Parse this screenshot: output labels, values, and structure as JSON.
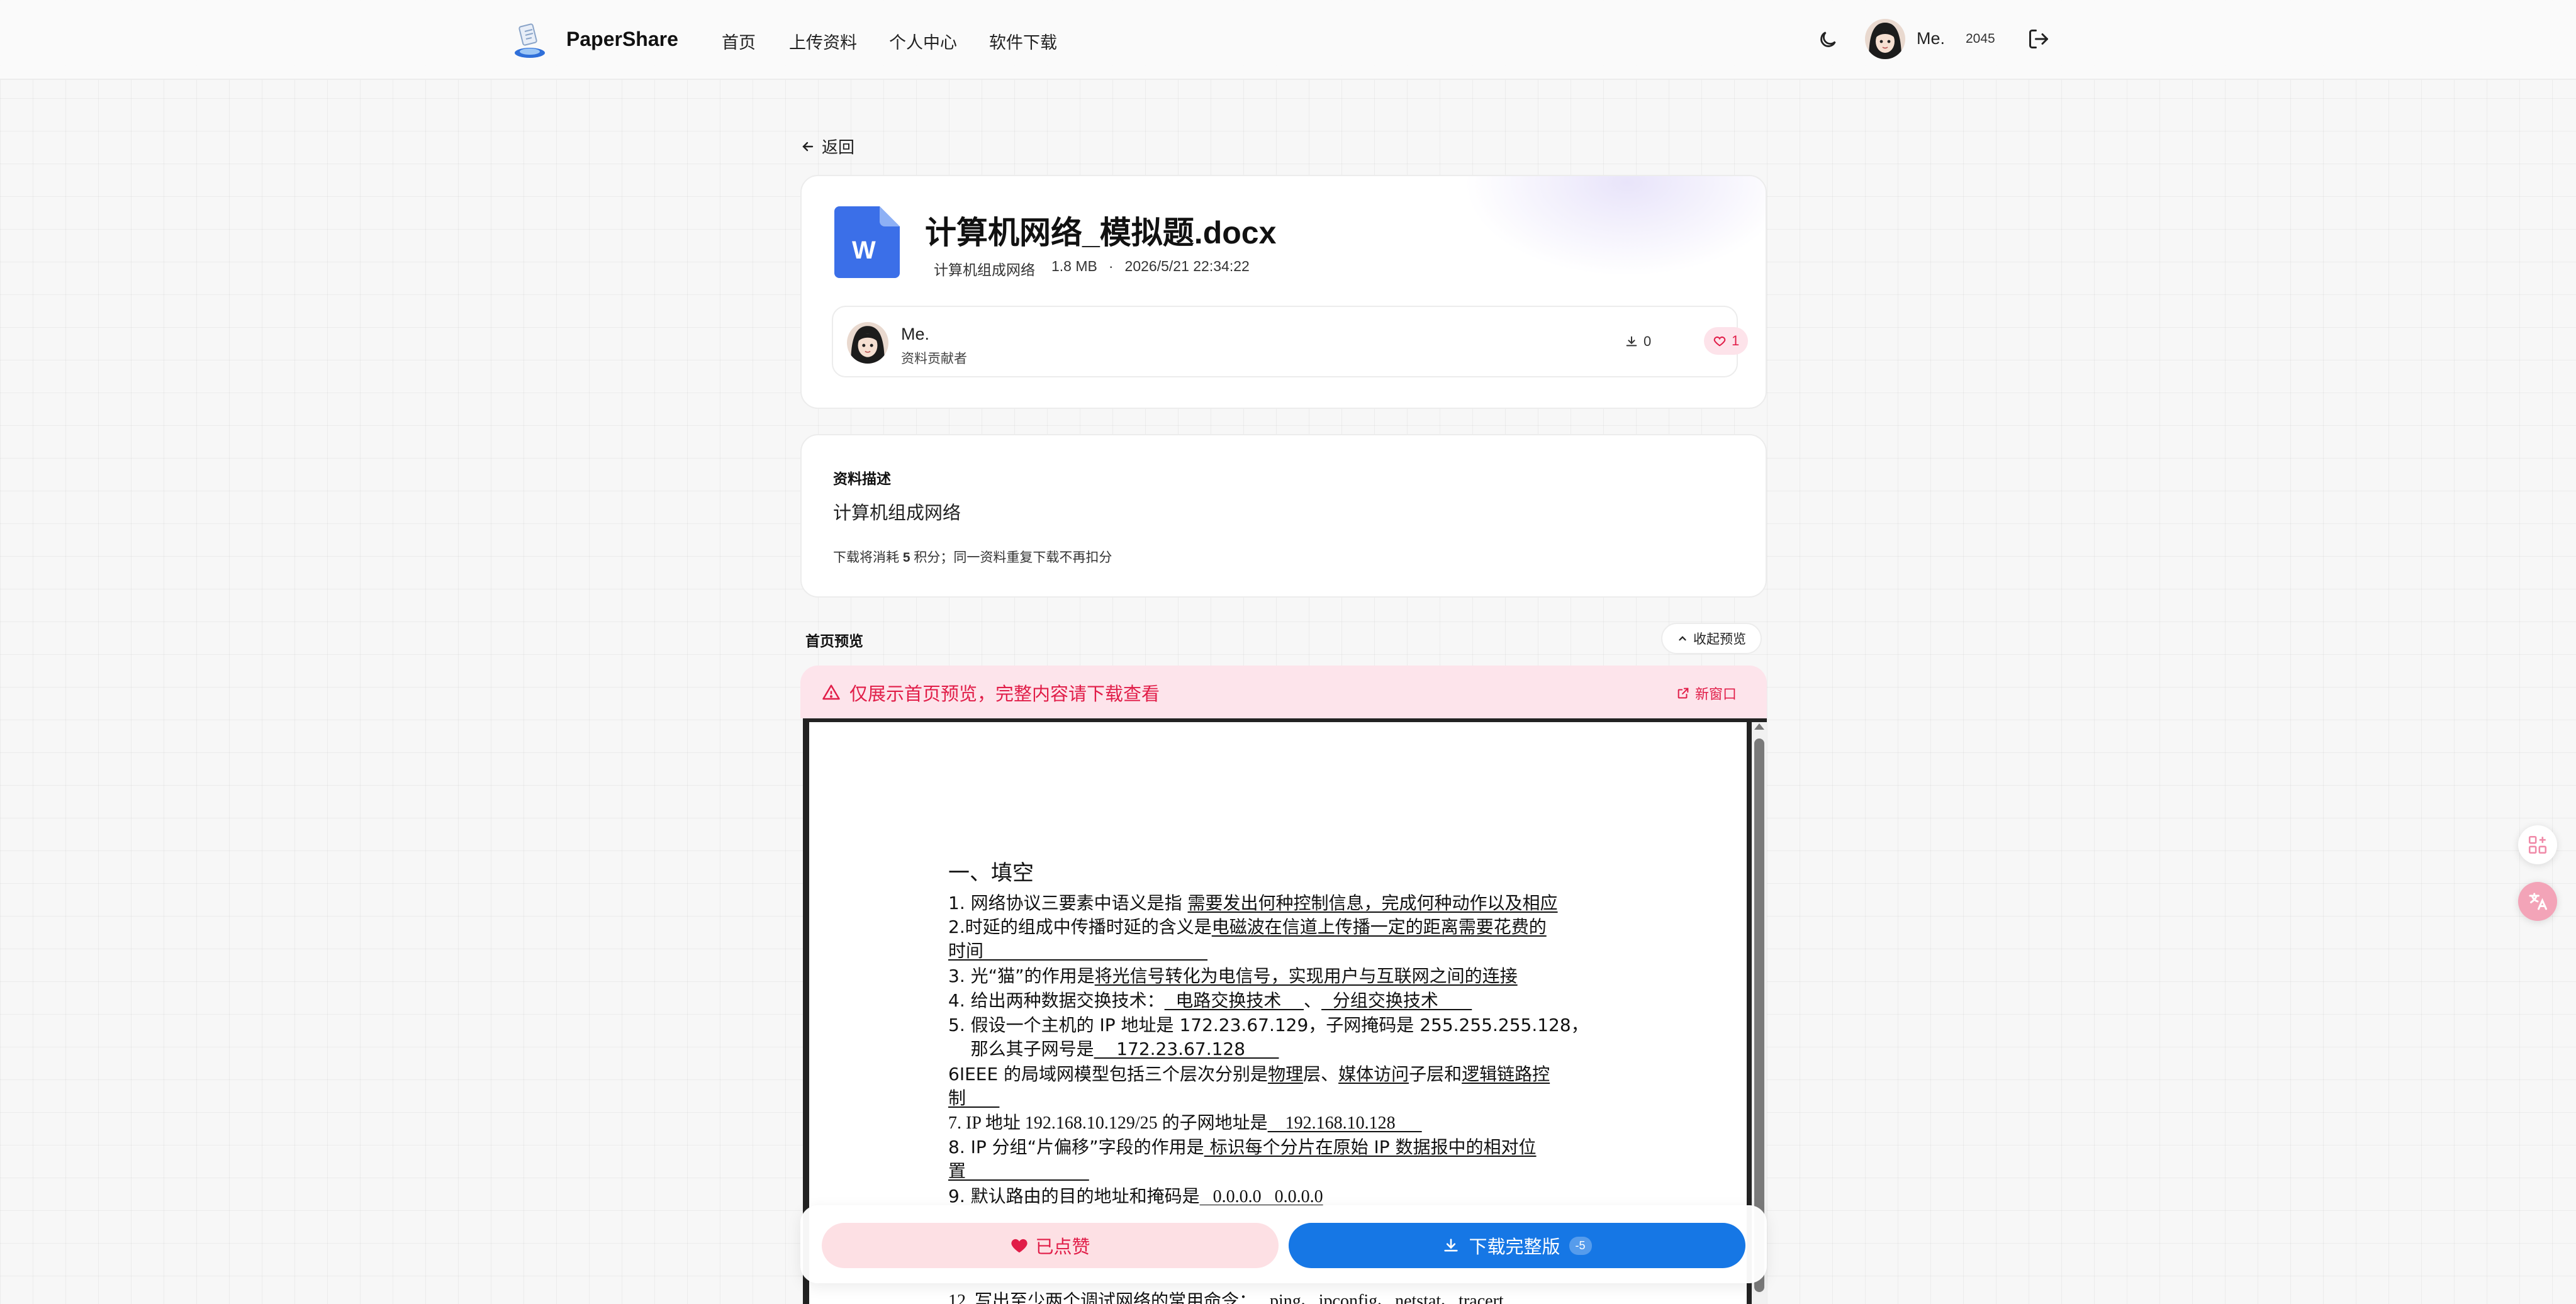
{
  "header": {
    "brand": "PaperShare",
    "nav": [
      "首页",
      "上传资料",
      "个人中心",
      "软件下载"
    ],
    "user_name": "Me.",
    "points": "2045"
  },
  "back_label": "返回",
  "file": {
    "title": "计算机网络_模拟题.docx",
    "category": "计算机组成网络",
    "size": "1.8 MB",
    "separator": "·",
    "date": "2026/5/21 22:34:22",
    "icon_letter": "W",
    "uploader": {
      "name": "Me.",
      "role": "资料贡献者"
    },
    "downloads": "0",
    "likes": "1"
  },
  "description": {
    "label": "资料描述",
    "text": "计算机组成网络",
    "note_prefix": "下载将消耗 ",
    "note_points": "5",
    "note_suffix": " 积分；同一资料重复下载不再扣分"
  },
  "preview": {
    "label": "首页预览",
    "collapse_label": "收起预览",
    "notice": "仅展示首页预览，完整内容请下载查看",
    "new_window": "新窗口"
  },
  "document": {
    "heading": "一、填空",
    "lines": [
      {
        "pre": "1. 网络协议三要素中语义是指 ",
        "u": "需要发出何种控制信息，完成何种动作以及相应",
        "post": ""
      },
      {
        "pre": "2.时延的组成中传播时延的含义是",
        "u": "电磁波在信道上传播一定的距离需要花费的",
        "post": ""
      },
      {
        "pre": "",
        "u": "时间                                        ",
        "post": ""
      },
      {
        "pre": "3. 光“猫”的作用是",
        "u": "将光信号转化为电信号，实现用户与互联网之间的连接",
        "post": ""
      },
      {
        "pre": "4. 给出两种数据交换技术：",
        "u": "  电路交换技术    ",
        "post": "、",
        "u2": "  分组交换技术      "
      },
      {
        "pre": "5. 假设一个主机的 IP 地址是 172.23.67.129，子网掩码是 255.255.255.128，",
        "u": "",
        "post": ""
      },
      {
        "pre": "    那么其子网号是",
        "u": "    172.23.67.128      ",
        "post": ""
      },
      {
        "pre": "6IEEE 的局域网模型包括三个层次分别是",
        "u": "物理",
        "post": "层、",
        "u2": "媒体访问",
        "post2": "子层和",
        "u3": "逻辑链路控"
      },
      {
        "pre": "",
        "u": "制      ",
        "post": ""
      },
      {
        "pre": "7. IP 地址 192.168.10.129/25 的子网地址是",
        "u": "    192.168.10.128      ",
        "post": ""
      },
      {
        "pre": "8. IP 分组“片偏移”字段的作用是",
        "u": " 标识每个分片在原始 IP 数据报中的相对位",
        "post": ""
      },
      {
        "pre": "",
        "u": "置                      ",
        "post": ""
      },
      {
        "pre": "9. 默认路由的目的地址和掩码是",
        "u": "   0.0.0.0   0.0.0.0",
        "post": ""
      }
    ],
    "last_line": "12. 写出至少两个调试网络的常用命令：   ping、ipconfig、netstat、tracert"
  },
  "actions": {
    "liked_label": "已点赞",
    "download_label": "下载完整版",
    "cost_badge": "-5"
  },
  "colors": {
    "accent_blue": "#1677e5",
    "accent_pink": "#e11d48",
    "word_blue": "#3b6fe8"
  }
}
